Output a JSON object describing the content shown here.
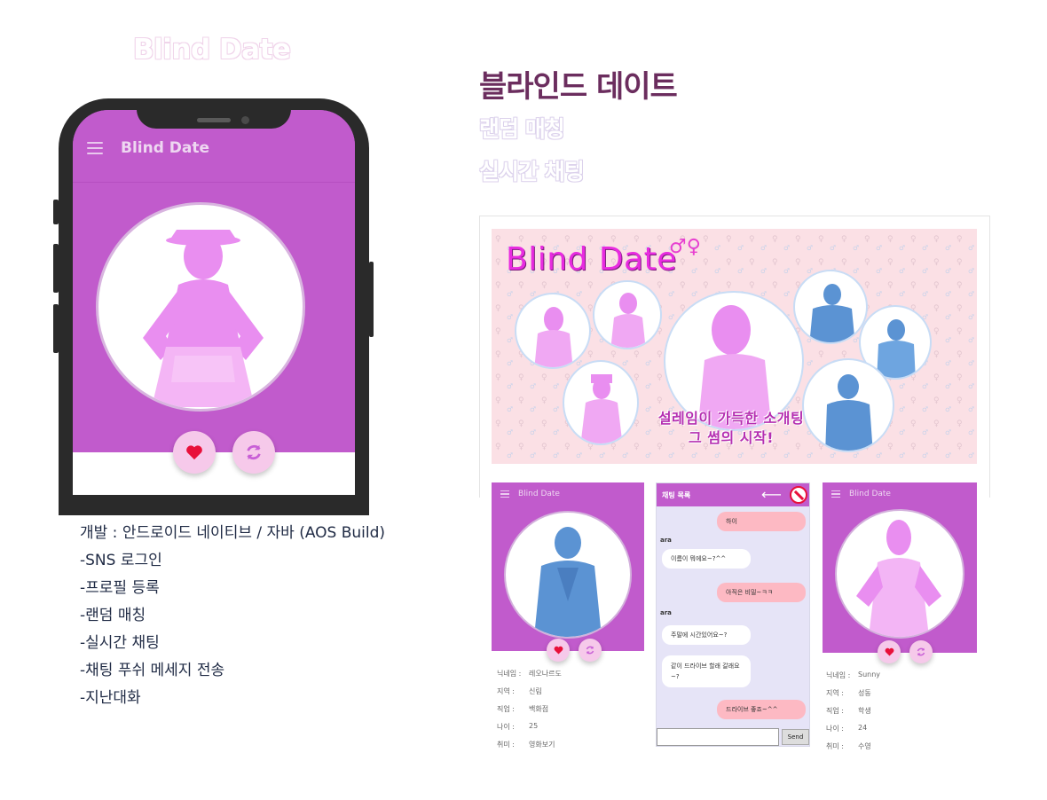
{
  "header": {
    "ghost_title": "Blind Date"
  },
  "right_header": {
    "title": "블라인드 데이트",
    "sub1": "랜덤 매칭",
    "sub2": "실시간 채팅"
  },
  "phone": {
    "app_title": "Blind Date",
    "icons": [
      "menu-icon",
      "heart-icon",
      "refresh-icon"
    ]
  },
  "banner": {
    "title": "Blind Date",
    "symbols": "♂♀",
    "slogan_line1": "설레임이 가득한 소개팅",
    "slogan_line2": "그 썸의 시작!"
  },
  "screen_male": {
    "app_title": "Blind Date",
    "fields": [
      {
        "key": "닉네임 :",
        "value": "레오나르도"
      },
      {
        "key": "지역 :",
        "value": "신림"
      },
      {
        "key": "직업 :",
        "value": "백화점"
      },
      {
        "key": "나이 :",
        "value": "25"
      },
      {
        "key": "취미 :",
        "value": "영화보기"
      }
    ]
  },
  "screen_chat": {
    "title": "채팅 목록",
    "messages": [
      {
        "from": "me",
        "text": "하이"
      },
      {
        "from": "ara",
        "name": "ara",
        "text": "이름이 뭐에요~?^^"
      },
      {
        "from": "me",
        "text": "아직은 비밀~ㅋㅋ"
      },
      {
        "from": "ara",
        "name": "ara",
        "text": "주말에 시간있어요~?"
      },
      {
        "from": "ara",
        "text": "같이 드라이브 할래 갈래요~?"
      },
      {
        "from": "me",
        "text": "드라이브 좋죠~^^"
      }
    ],
    "send_label": "Send"
  },
  "screen_female": {
    "app_title": "Blind Date",
    "fields": [
      {
        "key": "닉네임 :",
        "value": "Sunny"
      },
      {
        "key": "지역 :",
        "value": "성동"
      },
      {
        "key": "직업 :",
        "value": "학생"
      },
      {
        "key": "나이 :",
        "value": "24"
      },
      {
        "key": "취미 :",
        "value": "수영"
      }
    ]
  },
  "features": [
    "개발 : 안드로이드 네이티브 / 자바 (AOS Build)",
    "-SNS 로그인",
    "-프로필 등록",
    "-랜덤 매칭",
    "-실시간 채팅",
    "-채팅 푸쉬 메세지 전송",
    "-지난대화"
  ],
  "colors": {
    "app_purple": "#c15bcc",
    "title_plum": "#6b2d5e",
    "pink_silhouette": "#e98ef0",
    "blue_silhouette": "#5b93d3",
    "heart_red": "#e8103a"
  }
}
